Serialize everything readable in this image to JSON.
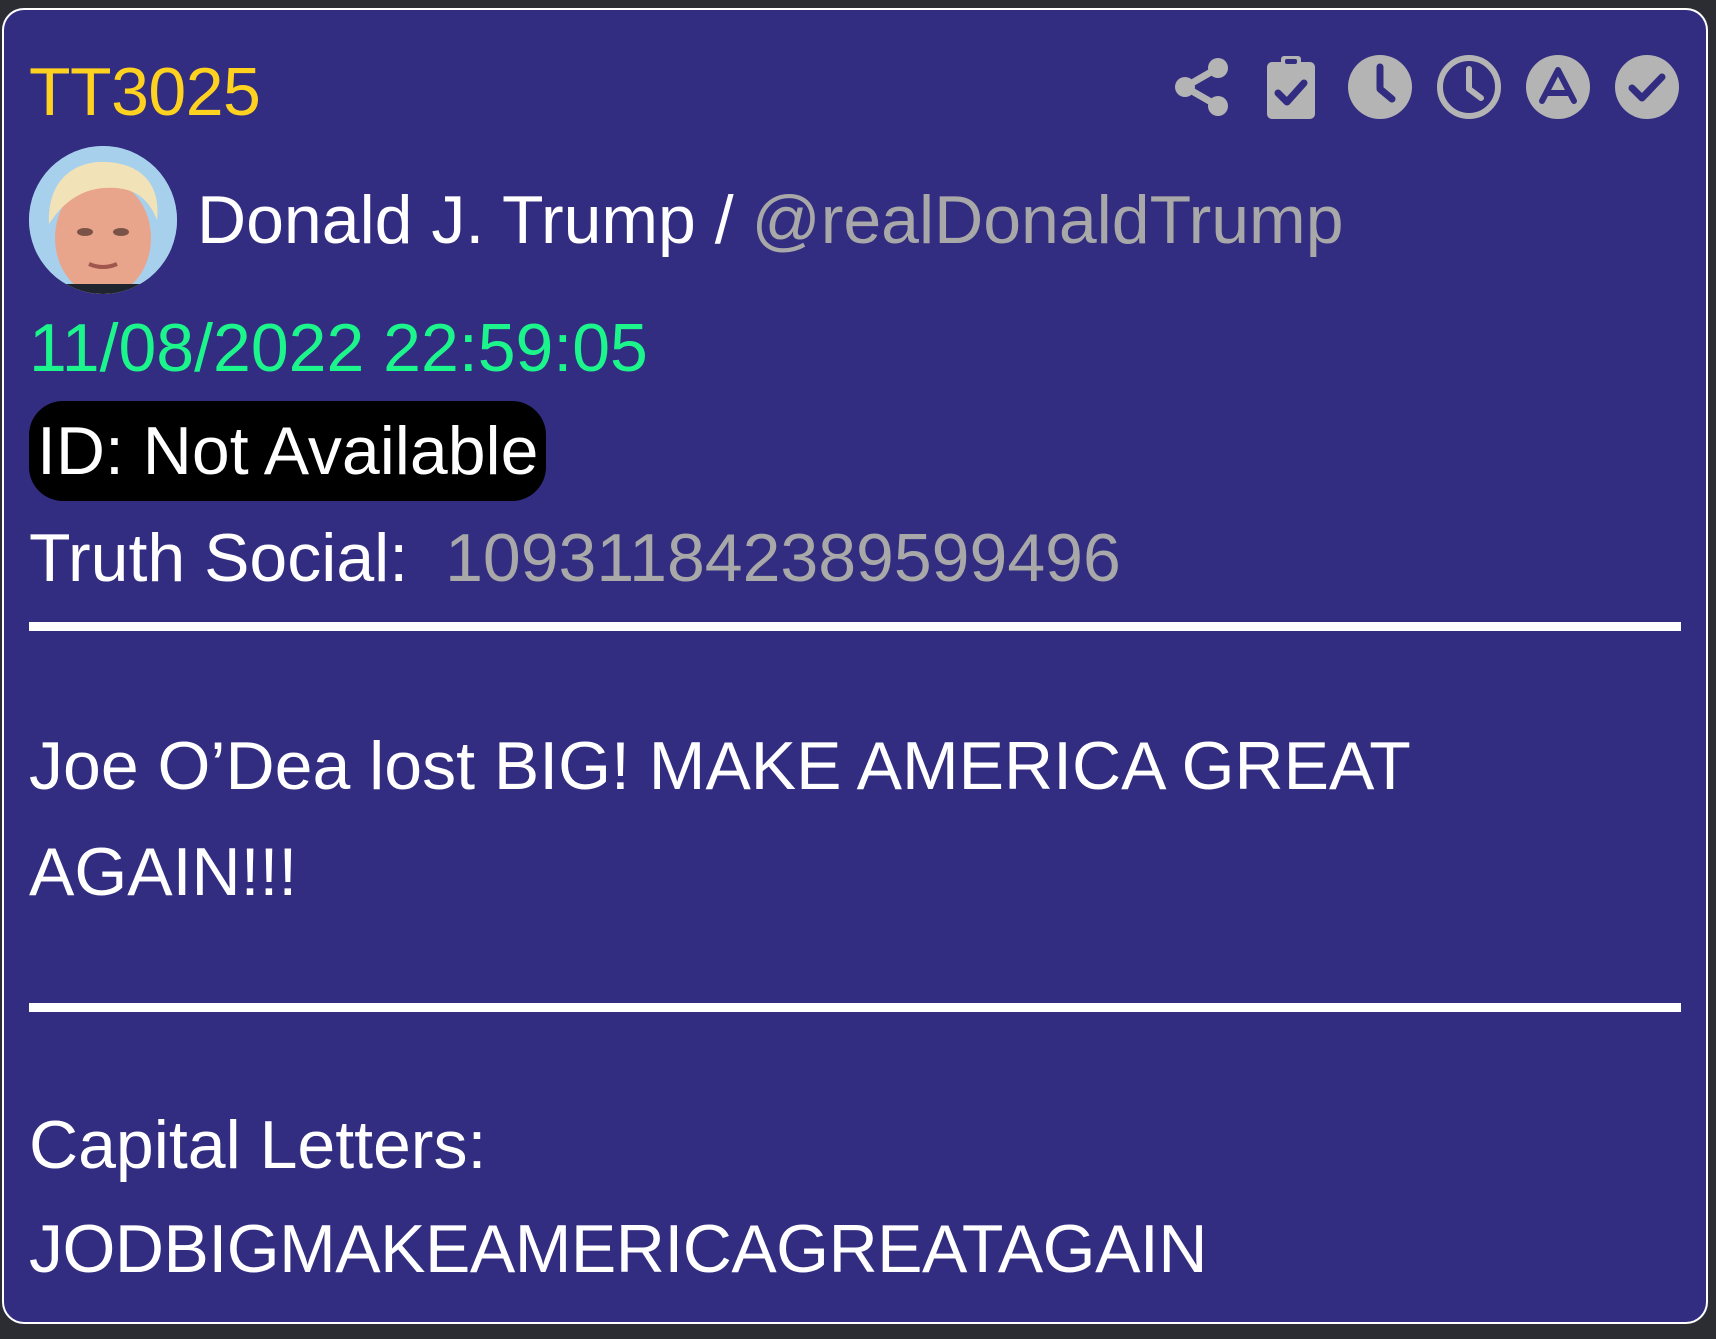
{
  "post": {
    "code": "TT3025",
    "author_name": "Donald J. Trump /",
    "author_handle": "@realDonaldTrump",
    "timestamp": "11/08/2022 22:59:05",
    "id_label": "ID: Not Available",
    "platform_label": "Truth Social:",
    "platform_id": "109311842389599496",
    "text": "Joe O’Dea lost BIG! MAKE AMERICA GREAT AGAIN!!!",
    "capital_letters_label": "Capital Letters:",
    "capital_letters_value": "JODBIGMAKEAMERICAGREATAGAIN"
  },
  "toolbar": {
    "icons": [
      "share-icon",
      "clipboard-check-icon",
      "clock-filled-icon",
      "clock-outline-icon",
      "letter-a-circle-icon",
      "check-circle-icon"
    ]
  },
  "colors": {
    "card_background": "#322d80",
    "code": "#ffd21f",
    "timestamp": "#1cf58c",
    "muted": "#a8a8a8",
    "icon": "#b4b4b4",
    "badge": "#000000"
  }
}
